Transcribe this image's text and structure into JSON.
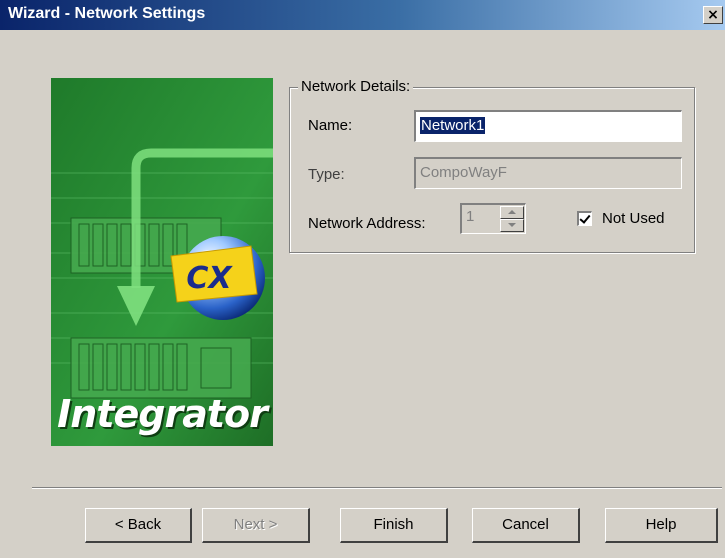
{
  "window": {
    "title": "Wizard - Network Settings",
    "close_glyph": "✕"
  },
  "side_image": {
    "brand_text": "Integrator",
    "logo_letter": "CX"
  },
  "network_details": {
    "legend": "Network Details:",
    "name_label": "Name:",
    "name_value": "Network1",
    "type_label": "Type:",
    "type_value": "CompoWayF",
    "address_label": "Network Address:",
    "address_value": "1",
    "not_used_label": "Not Used",
    "not_used_checked": true
  },
  "buttons": {
    "back": "< Back",
    "next": "Next >",
    "finish": "Finish",
    "cancel": "Cancel",
    "help": "Help"
  },
  "colors": {
    "title_bar_start": "#0a246a",
    "title_bar_end": "#a6caf0",
    "dialog_face": "#d4d0c8",
    "selection": "#0a246a",
    "image_green": "#2e8b3a"
  }
}
